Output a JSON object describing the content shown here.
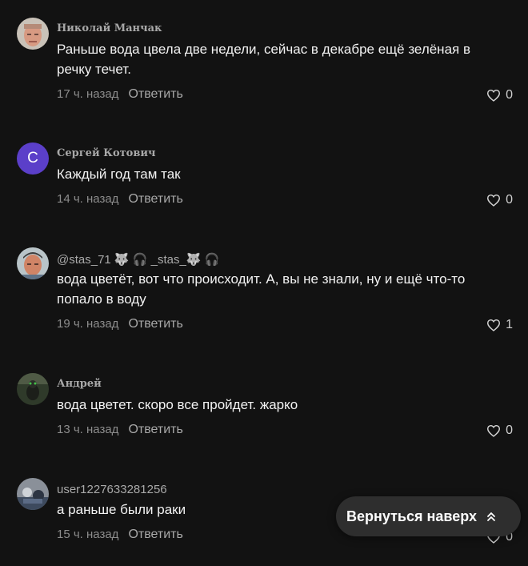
{
  "comments": [
    {
      "author": "Николай Манчак",
      "text": "Раньше вода цвела две недели, сейчас в декабре ещё зелёная в речку течет.",
      "time": "17 ч. назад",
      "reply_label": "Ответить",
      "likes": "0"
    },
    {
      "author": "Сергей Котович",
      "avatar_letter": "С",
      "avatar_color": "#5b3fc9",
      "text": "Каждый год там так",
      "time": "14 ч. назад",
      "reply_label": "Ответить",
      "likes": "0"
    },
    {
      "author": "@stas_71 🐺 🎧 _stas_🐺 🎧",
      "text": "вода цветёт, вот что происходит. А, вы не знали, ну и ещё что-то попало в воду",
      "time": "19 ч. назад",
      "reply_label": "Ответить",
      "likes": "1"
    },
    {
      "author": "Андрей",
      "text": "вода цветет. скоро все пройдет. жарко",
      "time": "13 ч. назад",
      "reply_label": "Ответить",
      "likes": "0"
    },
    {
      "author": "user1227633281256",
      "text": "а раньше были раки",
      "time": "15 ч. назад",
      "reply_label": "Ответить",
      "likes": "0"
    }
  ],
  "scroll_top": {
    "label": "Вернуться наверх",
    "icon": "double-chevron-up-icon"
  },
  "colors": {
    "background": "#121212",
    "button_background": "#2e2e2e"
  }
}
